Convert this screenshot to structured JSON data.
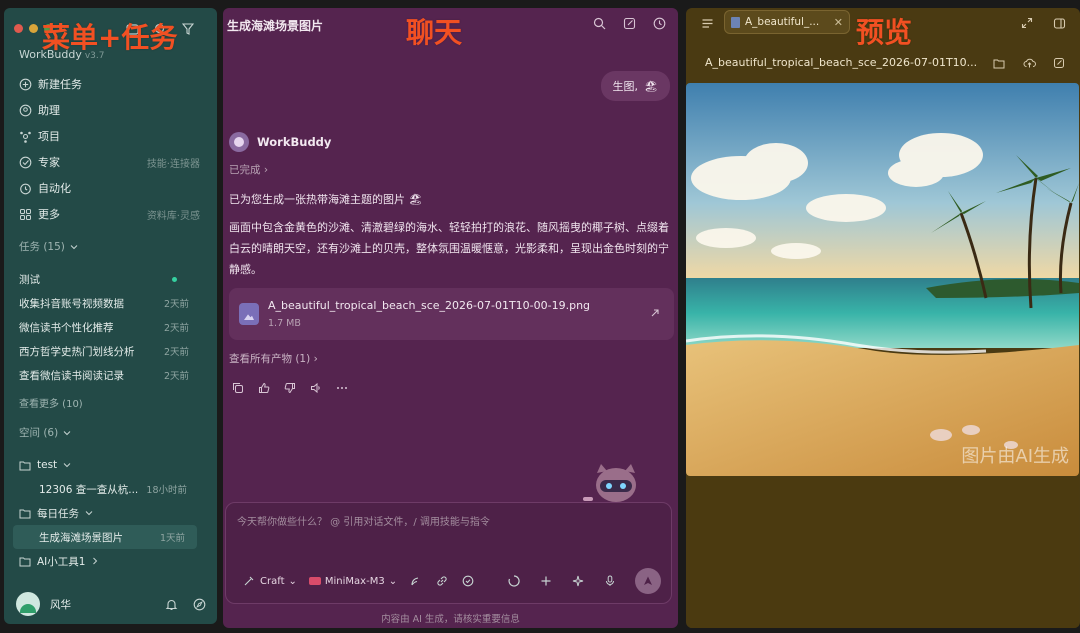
{
  "annotations": {
    "sidebar_label": "菜单+任务",
    "chat_label": "聊天",
    "preview_label": "预览"
  },
  "sidebar": {
    "brand": "WorkBuddy",
    "version": "v3.7",
    "nav": [
      {
        "icon": "plus-circle-icon",
        "label": "新建任务",
        "meta": ""
      },
      {
        "icon": "assistant-icon",
        "label": "助理",
        "meta": ""
      },
      {
        "icon": "project-icon",
        "label": "项目",
        "meta": ""
      },
      {
        "icon": "expert-icon",
        "label": "专家",
        "meta": "技能·连接器"
      },
      {
        "icon": "alarm-icon",
        "label": "自动化",
        "meta": ""
      },
      {
        "icon": "grid-icon",
        "label": "更多",
        "meta": "资料库·灵感"
      }
    ],
    "tasks_header": "任务 (15)",
    "tasks": [
      {
        "label": "测试",
        "meta": ""
      },
      {
        "label": "收集抖音账号视频数据",
        "meta": "2天前"
      },
      {
        "label": "微信读书个性化推荐",
        "meta": "2天前"
      },
      {
        "label": "西方哲学史热门划线分析",
        "meta": "2天前"
      },
      {
        "label": "查看微信读书阅读记录",
        "meta": "2天前"
      }
    ],
    "tasks_more": "查看更多 (10)",
    "spaces_header": "空间 (6)",
    "spaces": [
      {
        "label": "test",
        "meta": ""
      },
      {
        "label": "12306 查一查从杭...",
        "meta": "18小时前"
      },
      {
        "label": "每日任务",
        "meta": ""
      },
      {
        "label": "生成海滩场景图片",
        "meta": "1天前"
      },
      {
        "label": "AI小工具1",
        "meta": ""
      }
    ],
    "user": "风华"
  },
  "chat": {
    "title": "生成海滩场景图片",
    "user_message": "生图,",
    "user_emoji": "🏖",
    "bot_name": "WorkBuddy",
    "status": "已完成",
    "reply_line1": "已为您生成一张热带海滩主题的图片",
    "reply_emoji": "🏖",
    "reply_body": "画面中包含金黄色的沙滩、清澈碧绿的海水、轻轻拍打的浪花、随风摇曳的椰子树、点缀着白云的晴朗天空，还有沙滩上的贝壳，整体氛围温暖惬意，光影柔和，呈现出金色时刻的宁静感。",
    "file_name": "A_beautiful_tropical_beach_sce_2026-07-01T10-00-19.png",
    "file_size": "1.7 MB",
    "view_all": "查看所有产物 (1)",
    "input_placeholder": "今天帮你做些什么？ @ 引用对话文件，/ 调用技能与指令",
    "mode_label": "Craft",
    "model_label": "MiniMax-M3",
    "footnote": "内容由 AI 生成，请核实重要信息"
  },
  "preview": {
    "tab_label": "A_beautiful_...",
    "path": "A_beautiful_tropical_beach_sce_2026-07-01T10...",
    "watermark": "图片由AI生成"
  }
}
